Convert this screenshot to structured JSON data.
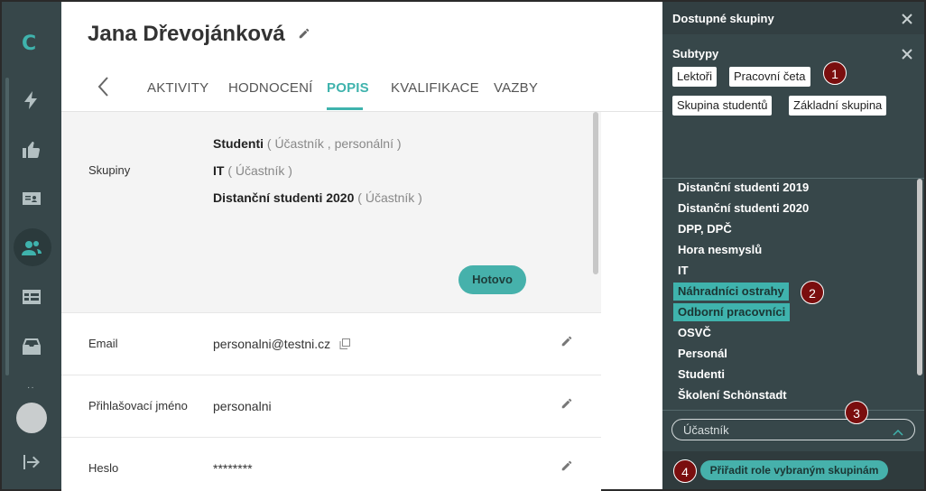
{
  "rail": {
    "logo": "C",
    "icons": [
      "flash-icon",
      "thumbs-up-icon",
      "id-card-icon",
      "people-icon",
      "table-icon",
      "inbox-icon",
      "logout-icon"
    ],
    "more": "··"
  },
  "person": {
    "name": "Jana Dřevojánková"
  },
  "tabs": [
    {
      "label": "AKTIVITY"
    },
    {
      "label": "HODNOCENÍ"
    },
    {
      "label": "POPIS"
    },
    {
      "label": "KVALIFIKACE"
    },
    {
      "label": "VAZBY"
    }
  ],
  "active_tab": "POPIS",
  "groups_section": {
    "label": "Skupiny",
    "groups": [
      {
        "name": "Studenti",
        "role": "( Účastník , personální )"
      },
      {
        "name": "IT",
        "role": "( Účastník )"
      },
      {
        "name": "Distanční studenti 2020",
        "role": "( Účastník )"
      }
    ],
    "done_label": "Hotovo"
  },
  "fields": [
    {
      "label": "Email",
      "value": "personalni@testni.cz"
    },
    {
      "label": "Přihlašovací jméno",
      "value": "personalni"
    },
    {
      "label": "Heslo",
      "value": "********"
    }
  ],
  "panel": {
    "title": "Dostupné skupiny",
    "subtypes_title": "Subtypy",
    "subtypes": [
      "Lektoři",
      "Pracovní četa",
      "Skupina studentů",
      "Základní skupina"
    ],
    "groups": [
      {
        "name": "Distanční studenti 2019",
        "selected": false
      },
      {
        "name": "Distanční studenti 2020",
        "selected": false
      },
      {
        "name": "DPP, DPČ",
        "selected": false
      },
      {
        "name": "Hora nesmyslů",
        "selected": false
      },
      {
        "name": "IT",
        "selected": false
      },
      {
        "name": "Náhradníci ostrahy",
        "selected": true
      },
      {
        "name": "Odborní pracovníci",
        "selected": true
      },
      {
        "name": "OSVČ",
        "selected": false
      },
      {
        "name": "Personál",
        "selected": false
      },
      {
        "name": "Studenti",
        "selected": false
      },
      {
        "name": "Školení Schönstadt",
        "selected": false
      }
    ],
    "role_select": "Účastník",
    "assign_label": "Přiřadit role vybraným skupinám"
  },
  "badges": [
    "1",
    "2",
    "3",
    "4"
  ],
  "colors": {
    "accent": "#3fb3ad",
    "rail": "#37474a",
    "badge": "#7a0e0e"
  }
}
